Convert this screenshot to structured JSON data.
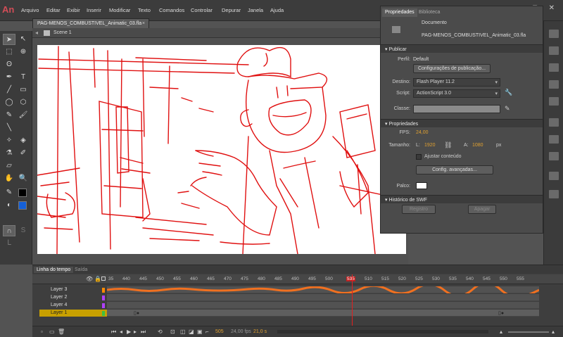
{
  "app": {
    "logo": "An"
  },
  "menu": [
    "Arquivo",
    "Editar",
    "Exibir",
    "Inserir",
    "Modificar",
    "Texto",
    "Comandos",
    "Controlar",
    "Depurar",
    "Janela",
    "Ajuda"
  ],
  "window_controls": "—  ▢  ✕",
  "document": {
    "tab": "PAG-MENOS_COMBUSTIVEL_Animatic_03.fla",
    "close": "×",
    "scene": "Scene 1"
  },
  "properties": {
    "tabs": [
      "Propriedades",
      "Biblioteca"
    ],
    "doc_type": "Documento",
    "doc_name": "PAG-MENOS_COMBUSTIVEL_Animatic_03.fla",
    "publish": {
      "section": "Publicar",
      "profile_label": "Perfil:",
      "profile_value": "Default",
      "settings_button": "Configurações de publicação...",
      "target_label": "Destino:",
      "target_value": "Flash Player 11.2",
      "script_label": "Script:",
      "script_value": "ActionScript 3.0",
      "class_label": "Classe:"
    },
    "props": {
      "section": "Propriedades",
      "fps_label": "FPS:",
      "fps_value": "24,00",
      "size_label": "Tamanho:",
      "w_label": "L:",
      "w_value": "1920",
      "h_label": "A:",
      "h_value": "1080",
      "unit": "px",
      "fit_label": "Ajustar conteúdo",
      "advanced_button": "Config. avançadas...",
      "stage_label": "Palco:",
      "stage_color": "#ffffff"
    },
    "history": {
      "section": "Histórico de SWF",
      "log_button": "Registro",
      "clear_button": "Apagar"
    }
  },
  "timeline": {
    "tabs": [
      "Linha do tempo",
      "Saída"
    ],
    "frames": [
      "35",
      "440",
      "445",
      "450",
      "455",
      "460",
      "465",
      "470",
      "475",
      "480",
      "485",
      "490",
      "495",
      "500",
      "535",
      "510",
      "515",
      "520",
      "525",
      "530",
      "535",
      "540",
      "545",
      "550",
      "555"
    ],
    "layers": [
      {
        "name": "Layer 3",
        "color": "#ff8a00"
      },
      {
        "name": "Layer 2",
        "color": "#b040ff"
      },
      {
        "name": "Layer 4",
        "color": "#b040ff"
      },
      {
        "name": "Layer 1",
        "color": "#40c040"
      }
    ],
    "current_frame": "505",
    "fps_display": "24,00 fps",
    "time_display": "21,0 s"
  }
}
